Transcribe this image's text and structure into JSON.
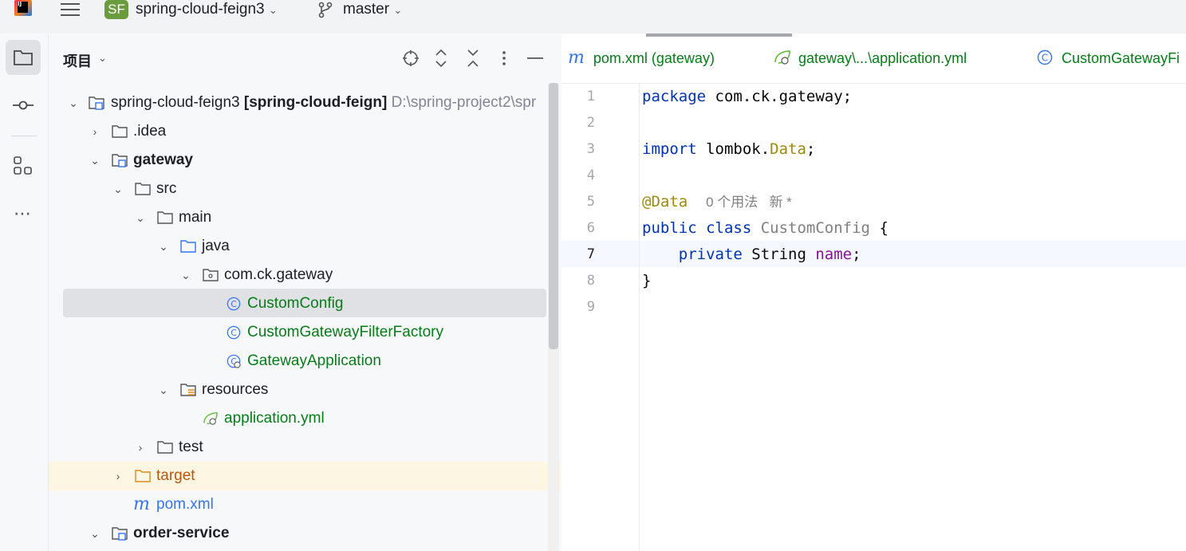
{
  "titlebar": {
    "logo_text": "IJ",
    "project_badge": "SF",
    "project_name": "spring-cloud-feign3",
    "branch": "master"
  },
  "toolstrip": {
    "items": [
      {
        "name": "project",
        "icon": "folder-icon"
      },
      {
        "name": "commit",
        "icon": "commit-icon"
      },
      {
        "name": "structure",
        "icon": "structure-icon"
      },
      {
        "name": "more",
        "label": "⋯"
      }
    ]
  },
  "project_panel": {
    "title": "项目",
    "tree": {
      "root": {
        "name": "spring-cloud-feign3",
        "module": "[spring-cloud-feign]",
        "path": "D:\\spring-project2\\spr"
      },
      "idea": ".idea",
      "gateway": "gateway",
      "src": "src",
      "main": "main",
      "java": "java",
      "package": "com.ck.gateway",
      "class1": "CustomConfig",
      "class2": "CustomGatewayFilterFactory",
      "class3": "GatewayApplication",
      "resources": "resources",
      "yml": "application.yml",
      "test": "test",
      "target": "target",
      "pom": "pom.xml",
      "order_service": "order-service"
    }
  },
  "editor": {
    "tabs": [
      {
        "icon": "m",
        "label": "pom.xml (gateway)"
      },
      {
        "label": "gateway\\...\\application.yml"
      },
      {
        "icon": "C",
        "label": "CustomGatewayFi"
      }
    ],
    "line_numbers": [
      "1",
      "2",
      "3",
      "4",
      "5",
      "6",
      "7",
      "8",
      "9"
    ],
    "code": {
      "l1_kw": "package",
      "l1_rest": " com.ck.gateway;",
      "l3_kw": "import",
      "l3_pkg": " lombok.",
      "l3_cls": "Data",
      "l3_end": ";",
      "l5_ann": "@Data",
      "l5_hint": "0 个用法   新 *",
      "l6_kw1": "public",
      "l6_kw2": " class",
      "l6_cls": " CustomConfig",
      "l6_end": " {",
      "l7_indent": "    ",
      "l7_kw": "private",
      "l7_type": " String",
      "l7_fld": " name",
      "l7_end": ";",
      "l8": "}"
    }
  },
  "colors": {
    "accent_green": "#067d17",
    "keyword": "#0033b3",
    "annotation": "#9e880d",
    "field": "#871094"
  }
}
